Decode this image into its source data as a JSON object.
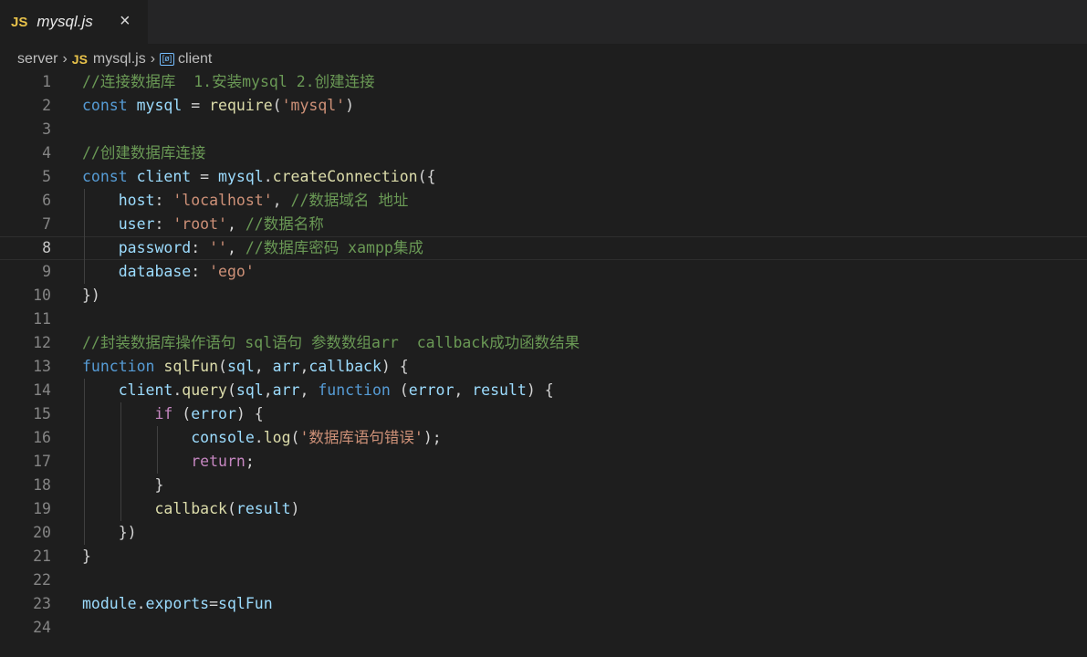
{
  "tab": {
    "icon": "JS",
    "label": "mysql.js",
    "close": "×"
  },
  "breadcrumb": {
    "folder": "server",
    "file_icon": "JS",
    "file": "mysql.js",
    "symbol": "client"
  },
  "editor": {
    "current_line": 8,
    "lines": [
      {
        "n": "1",
        "text": "//连接数据库  1.安装mysql 2.创建连接"
      },
      {
        "n": "2",
        "text": "const mysql = require('mysql')"
      },
      {
        "n": "3",
        "text": ""
      },
      {
        "n": "4",
        "text": "//创建数据库连接"
      },
      {
        "n": "5",
        "text": "const client = mysql.createConnection({"
      },
      {
        "n": "6",
        "text": "    host: 'localhost', //数据域名 地址"
      },
      {
        "n": "7",
        "text": "    user: 'root', //数据名称"
      },
      {
        "n": "8",
        "text": "    password: '', //数据库密码 xampp集成"
      },
      {
        "n": "9",
        "text": "    database: 'ego'"
      },
      {
        "n": "10",
        "text": "})"
      },
      {
        "n": "11",
        "text": ""
      },
      {
        "n": "12",
        "text": "//封装数据库操作语句 sql语句 参数数组arr  callback成功函数结果"
      },
      {
        "n": "13",
        "text": "function sqlFun(sql, arr,callback) {"
      },
      {
        "n": "14",
        "text": "    client.query(sql,arr, function (error, result) {"
      },
      {
        "n": "15",
        "text": "        if (error) {"
      },
      {
        "n": "16",
        "text": "            console.log('数据库语句错误');"
      },
      {
        "n": "17",
        "text": "            return;"
      },
      {
        "n": "18",
        "text": "        }"
      },
      {
        "n": "19",
        "text": "        callback(result)"
      },
      {
        "n": "20",
        "text": "    })"
      },
      {
        "n": "21",
        "text": "}"
      },
      {
        "n": "22",
        "text": ""
      },
      {
        "n": "23",
        "text": "module.exports=sqlFun"
      },
      {
        "n": "24",
        "text": ""
      }
    ]
  },
  "colors": {
    "background": "#1e1e1e",
    "tabbar": "#252526",
    "keyword": "#569cd6",
    "variable": "#9cdcfe",
    "function": "#dcdcaa",
    "string": "#ce9178",
    "comment": "#6a9955",
    "control": "#c586c0",
    "js_icon": "#e8c24a"
  }
}
